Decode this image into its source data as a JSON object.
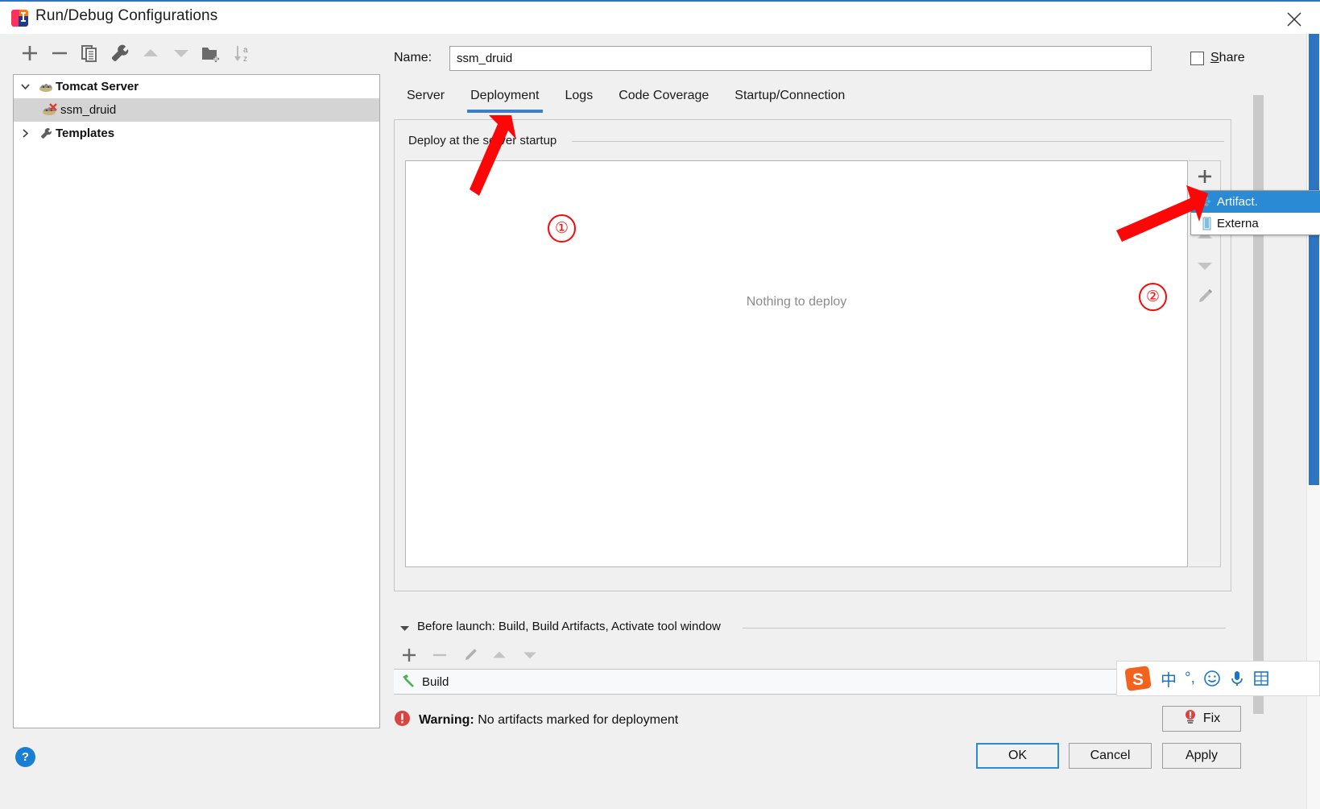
{
  "window": {
    "title": "Run/Debug Configurations",
    "logo_icon": "intellij-idea-logo",
    "close_icon": "close-icon"
  },
  "left_toolbar": {
    "buttons": [
      {
        "name": "add-configuration-button",
        "icon": "plus-icon"
      },
      {
        "name": "remove-configuration-button",
        "icon": "minus-icon"
      },
      {
        "name": "copy-configuration-button",
        "icon": "copy-icon"
      },
      {
        "name": "edit-templates-button",
        "icon": "wrench-icon"
      },
      {
        "name": "move-up-button",
        "icon": "triangle-up-icon"
      },
      {
        "name": "move-down-button",
        "icon": "triangle-down-icon"
      },
      {
        "name": "new-folder-button",
        "icon": "folder-add-icon"
      },
      {
        "name": "sort-alphabetically-button",
        "icon": "sort-az-icon"
      }
    ]
  },
  "tree": {
    "nodes": [
      {
        "label": "Tomcat Server",
        "icon": "tomcat-icon",
        "expanded": true,
        "selected": false,
        "level": 0
      },
      {
        "label": "ssm_druid",
        "icon": "tomcat-error-icon",
        "expanded": null,
        "selected": true,
        "level": 1
      },
      {
        "label": "Templates",
        "icon": "wrench-icon",
        "expanded": false,
        "selected": false,
        "level": 0
      }
    ]
  },
  "name_field": {
    "label": "Name:",
    "value": "ssm_druid",
    "placeholder": ""
  },
  "share": {
    "label_prefix": "S",
    "label_rest": "hare",
    "checked": false
  },
  "tabs": [
    {
      "label": "Server",
      "active": false
    },
    {
      "label": "Deployment",
      "active": true
    },
    {
      "label": "Logs",
      "active": false
    },
    {
      "label": "Code Coverage",
      "active": false
    },
    {
      "label": "Startup/Connection",
      "active": false
    }
  ],
  "deployment": {
    "group_legend": "Deploy at the server startup",
    "empty_text": "Nothing to deploy",
    "side_buttons": [
      {
        "name": "add-deployment-button",
        "icon": "plus-icon"
      },
      {
        "name": "move-up-deployment-button",
        "icon": "triangle-up-icon"
      },
      {
        "name": "move-down-deployment-button",
        "icon": "triangle-down-icon"
      },
      {
        "name": "edit-deployment-button",
        "icon": "pencil-icon"
      }
    ]
  },
  "artifact_popup": {
    "items": [
      {
        "label": "Artifact.",
        "icon": "artifact-icon",
        "selected": true
      },
      {
        "label": "Externa",
        "icon": "archive-icon",
        "selected": false
      }
    ]
  },
  "before_launch": {
    "header": "Before launch: Build, Build Artifacts, Activate tool window",
    "collapse_icon": "triangle-down-icon",
    "buttons": [
      {
        "name": "add-task-button",
        "icon": "plus-icon"
      },
      {
        "name": "remove-task-button",
        "icon": "minus-icon"
      },
      {
        "name": "edit-task-button",
        "icon": "pencil-icon"
      },
      {
        "name": "move-task-up-button",
        "icon": "triangle-up-icon"
      },
      {
        "name": "move-task-down-button",
        "icon": "triangle-down-icon"
      }
    ],
    "tasks": [
      {
        "label": "Build",
        "icon": "build-hammer-icon"
      }
    ]
  },
  "warning": {
    "icon": "error-icon",
    "prefix": "Warning:",
    "message": "No artifacts marked for deployment",
    "fix_label": "Fix",
    "fix_icon": "fix-bulb-icon"
  },
  "dialog_buttons": {
    "ok": "OK",
    "cancel": "Cancel",
    "apply": "Apply",
    "help_icon": "help-icon",
    "help_label": "?"
  },
  "annotations": {
    "markers": [
      {
        "label": "①",
        "name": "annotation-circle-1"
      },
      {
        "label": "②",
        "name": "annotation-circle-2"
      }
    ],
    "arrow_color": "#fb0707"
  },
  "ime_bar": {
    "items": [
      {
        "name": "sogou-logo-icon",
        "glyph": "S"
      },
      {
        "name": "chinese-mode-icon",
        "glyph": "中"
      },
      {
        "name": "punctuation-mode-icon",
        "glyph": "°,"
      },
      {
        "name": "emoji-icon",
        "glyph": "☺"
      },
      {
        "name": "voice-input-icon",
        "glyph": "ᵩ"
      },
      {
        "name": "toolbox-icon",
        "glyph": "▤"
      }
    ]
  },
  "colors": {
    "accent": "#2f74c0",
    "tab_active_underline": "#3c7fc4",
    "selection": "#2a8ad4",
    "annotation_red": "#fb0707",
    "warning_red": "#d64541"
  }
}
